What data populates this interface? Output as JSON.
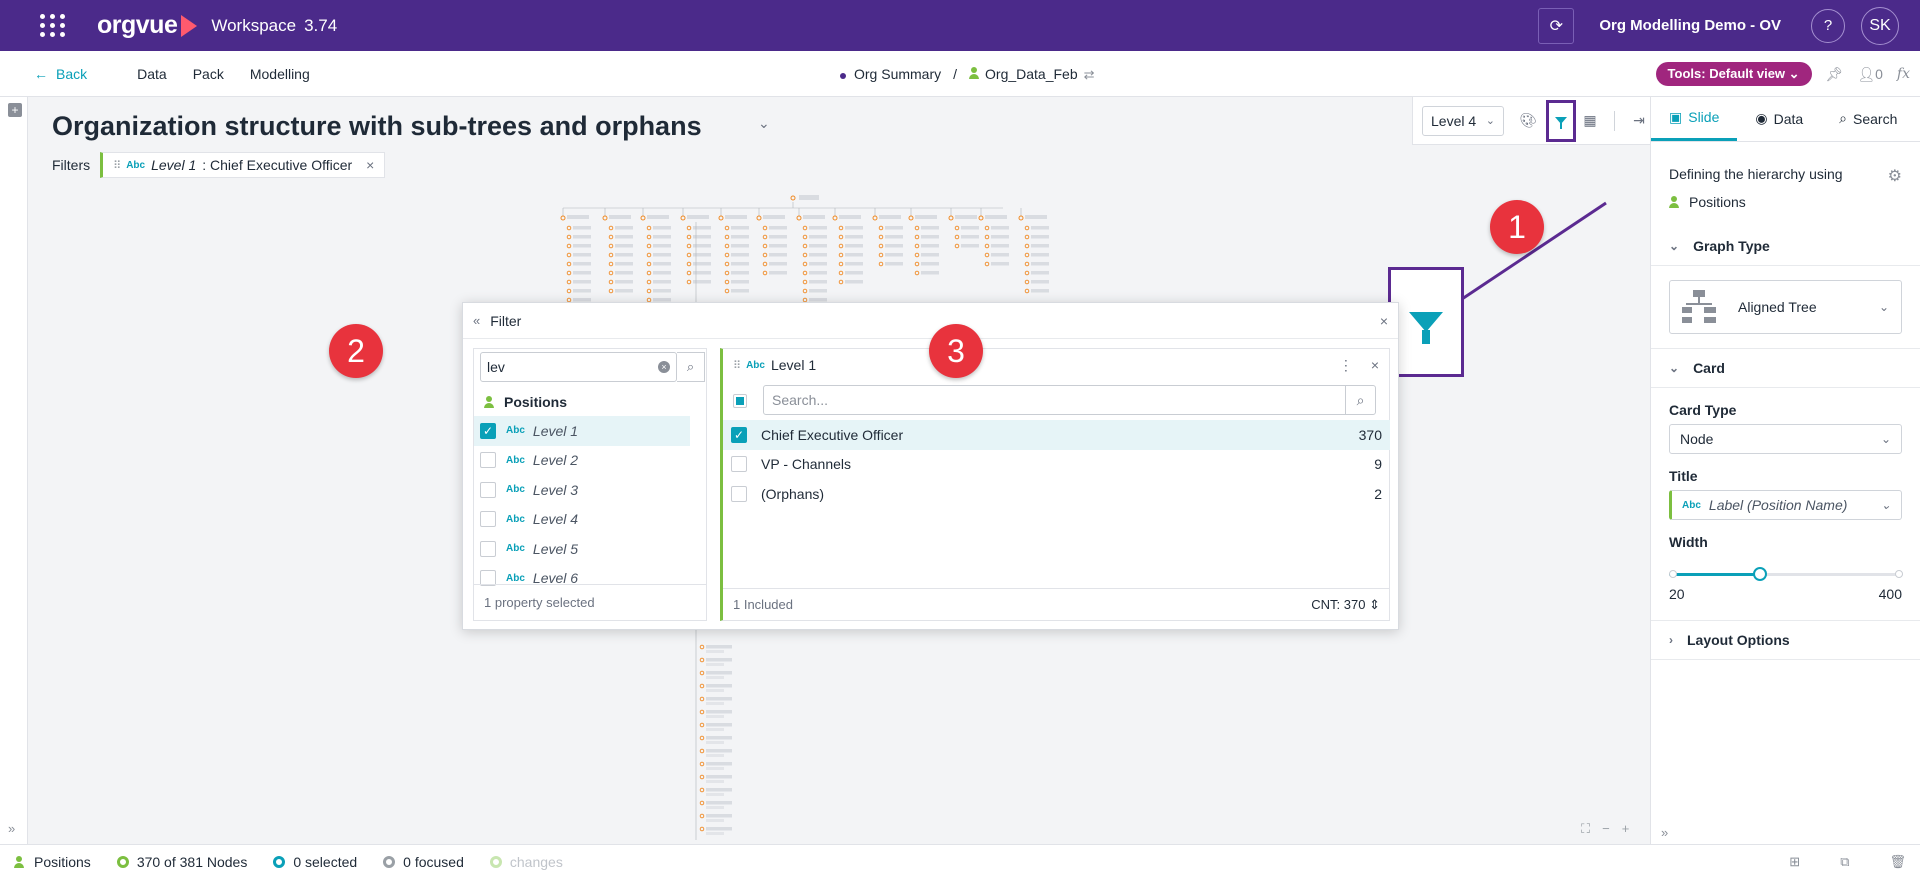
{
  "topbar": {
    "logo": "orgvue",
    "workspace_label": "Workspace",
    "version": "3.74",
    "org_name": "Org Modelling Demo - OV",
    "help": "?",
    "avatar_initials": "SK",
    "bg_color": "#4b2a8a"
  },
  "nav": {
    "back": "Back",
    "items": [
      "Data",
      "Pack",
      "Modelling"
    ],
    "breadcrumb": {
      "summary": "Org Summary",
      "separator": "/",
      "dataset": "Org_Data_Feb"
    },
    "tools": "Tools: Default view",
    "people_count": "0",
    "fx": "fx"
  },
  "canvas": {
    "title": "Organization structure with sub-trees and orphans",
    "filters_label": "Filters",
    "filter_chip": {
      "type": "Abc",
      "property": "Level 1",
      "value": ": Chief Executive Officer"
    },
    "level_select": "Level 4"
  },
  "callouts": {
    "badge1": "1",
    "badge2": "2",
    "badge3": "3",
    "color": "#e8333d",
    "outline_color": "#5b2a91"
  },
  "filter_dialog": {
    "title": "Filter",
    "property_search_value": "lev",
    "group": "Positions",
    "properties": [
      {
        "label": "Level 1",
        "checked": true
      },
      {
        "label": "Level 2",
        "checked": false
      },
      {
        "label": "Level 3",
        "checked": false
      },
      {
        "label": "Level 4",
        "checked": false
      },
      {
        "label": "Level 5",
        "checked": false
      },
      {
        "label": "Level 6",
        "checked": false
      }
    ],
    "property_footer": "1 property selected",
    "value_panel_title": "Level 1",
    "value_search_placeholder": "Search...",
    "values": [
      {
        "label": "Chief Executive Officer",
        "count": "370",
        "checked": true
      },
      {
        "label": "VP - Channels",
        "count": "9",
        "checked": false
      },
      {
        "label": "(Orphans)",
        "count": "2",
        "checked": false
      }
    ],
    "value_footer_left": "1 Included",
    "value_footer_right": "CNT: 370"
  },
  "right_panel": {
    "tabs": [
      "Slide",
      "Data",
      "Search"
    ],
    "defining_label": "Defining the hierarchy using",
    "hierarchy": "Positions",
    "graph_type_header": "Graph Type",
    "graph_type": "Aligned Tree",
    "card_header": "Card",
    "card_type_label": "Card Type",
    "card_type": "Node",
    "title_label": "Title",
    "title_value": "Label (Position Name)",
    "width_label": "Width",
    "width_min": "20",
    "width_max": "400",
    "width_value_fraction": 0.39,
    "layout_options": "Layout Options"
  },
  "statusbar": {
    "dataset": "Positions",
    "nodes": "370 of 381 Nodes",
    "selected": "0 selected",
    "focused": "0 focused",
    "changes": "changes"
  },
  "colors": {
    "accent": "#0aa0b8",
    "green": "#7cbf40",
    "tools_pill": "#a0267e",
    "node_orange": "#f08a24"
  }
}
